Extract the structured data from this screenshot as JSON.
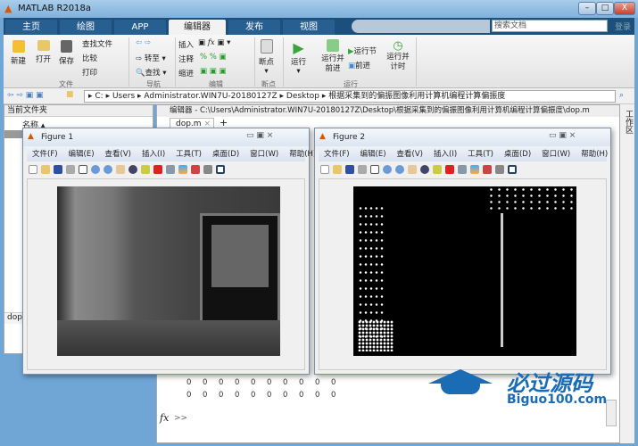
{
  "window": {
    "title": "MATLAB R2018a",
    "min": "–",
    "max": "□",
    "close": "X"
  },
  "tabs": [
    "主页",
    "绘图",
    "APP",
    "编辑器",
    "发布",
    "视图"
  ],
  "active_tab": "编辑器",
  "search": {
    "placeholder": "搜索文档",
    "login": "登录"
  },
  "ribbon": {
    "file": {
      "new": "新建",
      "open": "打开",
      "save": "保存",
      "find_files": "查找文件",
      "compare": "比较",
      "print": "打印",
      "label": "文件"
    },
    "nav": {
      "goto": "转至",
      "find": "查找",
      "label": "导航"
    },
    "edit": {
      "insert": "插入",
      "comment": "注释",
      "indent": "缩进",
      "label": "编辑"
    },
    "breakpoints": {
      "bp": "断点",
      "label": "断点"
    },
    "run": {
      "run": "运行",
      "run_advance": "运行并前进",
      "run_section": "运行节",
      "advance": "前进",
      "run_time": "运行并计时",
      "label": "运行"
    }
  },
  "address": {
    "path": [
      "C:",
      "Users",
      "Administrator.WIN7U-20180127Z",
      "Desktop",
      "根据采集到的偏振图像利用计算机编程计算偏振度"
    ]
  },
  "left_panel": {
    "title": "当前文件夹",
    "col_name": "名称",
    "detail": "dop"
  },
  "editor": {
    "title": "编辑器 - C:\\Users\\Administrator.WIN7U-20180127Z\\Desktop\\根据采集到的偏振图像利用计算机编程计算偏振度\\dop.m",
    "tab": "dop.m",
    "add": "+"
  },
  "right_strip": {
    "label": "工作区"
  },
  "figure_menu": [
    "文件(F)",
    "编辑(E)",
    "查看(V)",
    "插入(I)",
    "工具(T)",
    "桌面(D)",
    "窗口(W)",
    "帮助(H)"
  ],
  "figures": [
    {
      "title": "Figure 1"
    },
    {
      "title": "Figure 2"
    }
  ],
  "command": {
    "rows": [
      [
        "0",
        "0",
        "0",
        "0",
        "0",
        "0",
        "0",
        "0",
        "0",
        "0"
      ],
      [
        "0",
        "0",
        "0",
        "0",
        "0",
        "0",
        "0",
        "0",
        "0",
        "0"
      ]
    ],
    "fx": "fx",
    "prompt": ">>"
  },
  "watermark": {
    "cn": "必过源码",
    "en": "Biguo100.com"
  }
}
